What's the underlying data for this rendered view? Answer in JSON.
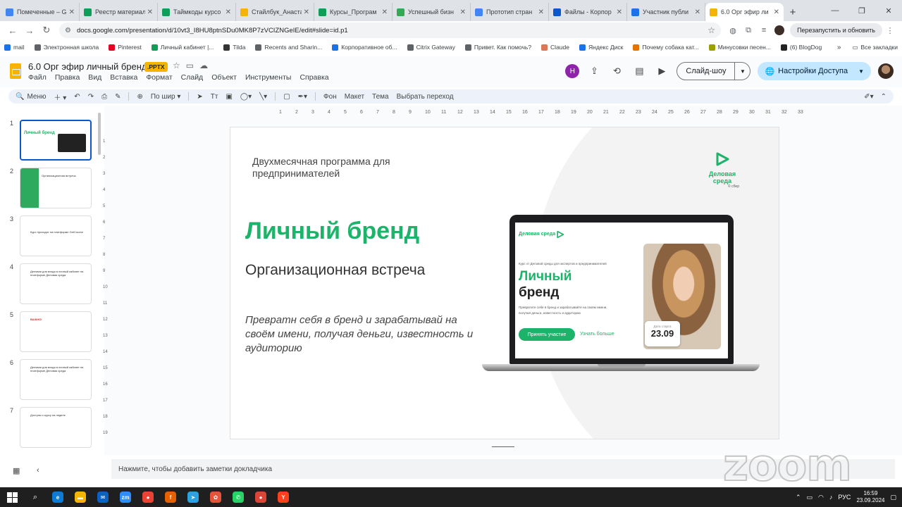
{
  "browser": {
    "tabs": [
      {
        "label": "Помеченные – G",
        "color": "#4285f4"
      },
      {
        "label": "Реестр материал",
        "color": "#0f9d58"
      },
      {
        "label": "Таймкоды курсо",
        "color": "#0f9d58"
      },
      {
        "label": "Стайлбук_Анаста",
        "color": "#f4b400"
      },
      {
        "label": "Курсы_Програм",
        "color": "#0f9d58"
      },
      {
        "label": "Успешный бизн",
        "color": "#34a853"
      },
      {
        "label": "Прототип стран",
        "color": "#4285f4"
      },
      {
        "label": "Файлы - Корпор",
        "color": "#0b57d0"
      },
      {
        "label": "Участник публи",
        "color": "#1a73e8"
      },
      {
        "label": "6.0 Орг эфир ли",
        "color": "#f4b400",
        "active": true
      }
    ],
    "url": "docs.google.com/presentation/d/10vt3_I8HU8ptnSDu0MK8P7zVCIZNGeIE/edit#slide=id.p1",
    "relaunch_label": "Перезапустить и обновить",
    "bookmarks": [
      {
        "label": "mail",
        "color": "#1a73e8"
      },
      {
        "label": "Электронная школа",
        "color": "#5f6368"
      },
      {
        "label": "Pinterest",
        "color": "#e60023"
      },
      {
        "label": "Личный кабинет |...",
        "color": "#0f9d58"
      },
      {
        "label": "Tilda",
        "color": "#333333"
      },
      {
        "label": "Recents and Sharin...",
        "color": "#5f6368"
      },
      {
        "label": "Корпоративное об...",
        "color": "#1a73e8"
      },
      {
        "label": "Citrix Gateway",
        "color": "#5f6368"
      },
      {
        "label": "Привет. Как помочь?",
        "color": "#5f6368"
      },
      {
        "label": "Claude",
        "color": "#d97757"
      },
      {
        "label": "Яндекс Диск",
        "color": "#1a73e8"
      },
      {
        "label": "Почему собака кат...",
        "color": "#e37400"
      },
      {
        "label": "Минусовки песен...",
        "color": "#9aa000"
      },
      {
        "label": "(6) BlogDog",
        "color": "#222222"
      }
    ],
    "bookmarks_all": "Все закладки"
  },
  "app": {
    "title": "6.0 Орг эфир личный бренд",
    "badge": ".PPTX",
    "menu": [
      "Файл",
      "Правка",
      "Вид",
      "Вставка",
      "Формат",
      "Слайд",
      "Объект",
      "Инструменты",
      "Справка"
    ],
    "user_initial": "Н",
    "slideshow_label": "Слайд-шоу",
    "share_label": "Настройки Доступа"
  },
  "toolbar": {
    "menu_label": "Меню",
    "zoom_label": "По шир",
    "background_label": "Фон",
    "layout_label": "Макет",
    "theme_label": "Тема",
    "transition_label": "Выбрать переход"
  },
  "filmstrip": {
    "slides": [
      {
        "num": "1",
        "title": "Личный бренд"
      },
      {
        "num": "2",
        "title": "Организационная встреча"
      },
      {
        "num": "3",
        "title": "Курс проходит на платформе GetCourse"
      },
      {
        "num": "4",
        "title": "Деловая для входа в личный кабинет на платформе Деловая среда"
      },
      {
        "num": "5",
        "title": "ВАЖНО!"
      },
      {
        "num": "6",
        "title": "Деловая для входа в личный кабинет на платформе Деловая среда"
      },
      {
        "num": "7",
        "title": "Доступы к курсу на неделе"
      }
    ]
  },
  "ruler": {
    "h_ticks": [
      "1",
      "2",
      "3",
      "4",
      "5",
      "6",
      "7",
      "8",
      "9",
      "10",
      "11",
      "12",
      "13",
      "14",
      "15",
      "16",
      "17",
      "18",
      "19",
      "20",
      "21",
      "22",
      "23",
      "24",
      "25",
      "26",
      "27",
      "28",
      "29",
      "30",
      "31",
      "32",
      "33"
    ],
    "v_ticks": [
      "1",
      "2",
      "3",
      "4",
      "5",
      "6",
      "7",
      "8",
      "9",
      "10",
      "11",
      "12",
      "13",
      "14",
      "15",
      "16",
      "17",
      "18",
      "19"
    ]
  },
  "slide": {
    "subtitle": "Двухмесячная программа для предпринимателей",
    "title": "Личный бренд",
    "subheading": "Организационная встреча",
    "tagline": "Превратн себя в бренд и зарабатывай на своём имени, получая деньги, известность и аудиторию",
    "logo_line1": "Деловая",
    "logo_line2": "среда",
    "logo_small": "© сбер",
    "laptop": {
      "brand": "Деловая среда",
      "small": "Курс от Деловой среды для экспертов и предпринимателей",
      "title1": "Личный",
      "title2": "бренд",
      "desc": "Превратите себя в бренд и зарабатывайте на своём имени, получая деньги, известность и аудиторию",
      "button": "Принять участие",
      "link": "Узнать больше",
      "date_label": "Дата старта",
      "date": "23.09"
    }
  },
  "notes_placeholder": "Нажмите, чтобы добавить заметки докладчика",
  "zoom_watermark": "zoom",
  "taskbar": {
    "apps": [
      {
        "name": "edge",
        "color": "#0c7bd5",
        "glyph": "e"
      },
      {
        "name": "explorer",
        "color": "#f4b400",
        "glyph": "▬"
      },
      {
        "name": "mail",
        "color": "#0b62c4",
        "glyph": "✉"
      },
      {
        "name": "zoom",
        "color": "#2d8cff",
        "glyph": "zm"
      },
      {
        "name": "chrome",
        "color": "#ea4335",
        "glyph": "●"
      },
      {
        "name": "firefox",
        "color": "#e66000",
        "glyph": "f"
      },
      {
        "name": "telegram",
        "color": "#2aa3e0",
        "glyph": "➤"
      },
      {
        "name": "photos",
        "color": "#e8523a",
        "glyph": "✿"
      },
      {
        "name": "whatsapp",
        "color": "#25d366",
        "glyph": "✆"
      },
      {
        "name": "chrome-2",
        "color": "#db4437",
        "glyph": "●"
      },
      {
        "name": "yandex",
        "color": "#fc3f1d",
        "glyph": "Y"
      }
    ],
    "lang": "РУС",
    "time": "16:59",
    "date": "23.09.2024"
  },
  "colors": {
    "accent": "#1db36a",
    "share_bg": "#c2e7ff",
    "active_border": "#0b57d0"
  }
}
